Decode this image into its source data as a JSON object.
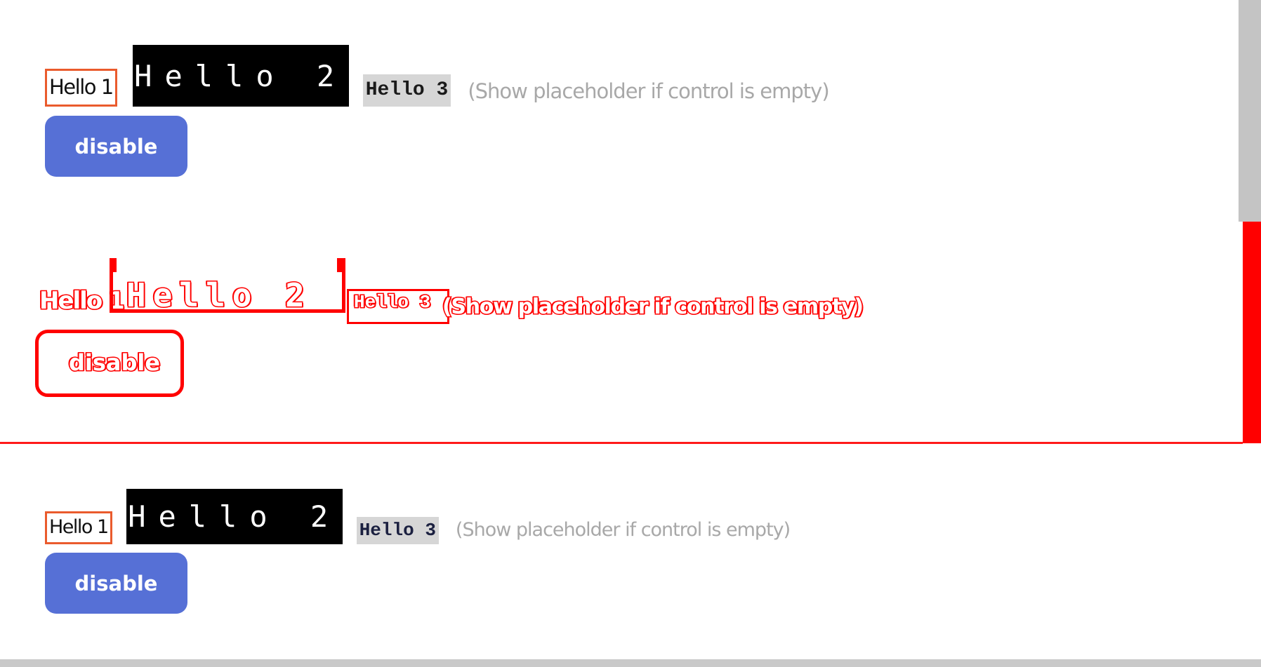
{
  "top_panel": {
    "hello1": "Hello 1",
    "hello2": "Hello 2",
    "hello3": "Hello 3",
    "placeholder": "(Show placeholder if control is empty)",
    "button_label": "disable"
  },
  "diff_panel": {
    "hello1": "Hello 1",
    "hello2": "Hello 2",
    "hello3": "Hello 3",
    "placeholder": "(Show placeholder if control is empty)",
    "button_label": "disable"
  },
  "bottom_panel": {
    "hello1": "Hello 1",
    "hello2": "Hello 2",
    "hello3": "Hello 3",
    "placeholder": "(Show placeholder if control is empty)",
    "button_label": "disable"
  },
  "colors": {
    "hello1_border": "#ea5b2d",
    "hello2_bg": "#000000",
    "hello3_bg": "#d6d6d6",
    "placeholder_text": "#a8a8a8",
    "button_bg": "#5670d6",
    "diff_highlight": "#ff0000",
    "scrollbar": "#c4c4c4"
  }
}
